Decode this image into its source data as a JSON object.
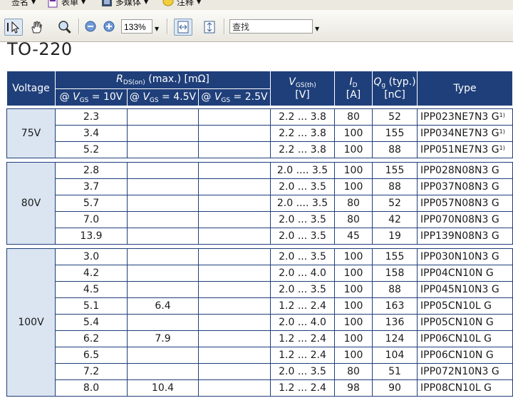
{
  "menubar": {
    "items": [
      {
        "label": "签名",
        "icon": "pen-icon"
      },
      {
        "label": "表单",
        "icon": "form-icon"
      },
      {
        "label": "多媒体",
        "icon": "film-icon"
      },
      {
        "label": "注释",
        "icon": "comment-icon"
      }
    ]
  },
  "toolbar": {
    "zoom_value": "133%",
    "find_placeholder": "查找"
  },
  "document": {
    "title": "TO-220",
    "header": {
      "voltage": "Voltage",
      "rds_label": "R",
      "rds_sub": "DS(on)",
      "rds_rest": " (max.) [mΩ]",
      "vgs10_pre": "@ ",
      "vgs10_v": "V",
      "vgs10_sub": "GS",
      "vgs10_post": " = 10V",
      "vgs45_post": " = 4.5V",
      "vgs25_post": " = 2.5V",
      "vgsth_v": "V",
      "vgsth_sub": "GS(th)",
      "vgsth_unit": "[V]",
      "id_i": "I",
      "id_sub": "D",
      "id_unit": "[A]",
      "qg_q": "Q",
      "qg_sub": "g",
      "qg_rest": " (typ.)",
      "qg_unit": "[nC]",
      "type": "Type"
    },
    "groups": [
      {
        "voltage": "75V",
        "rows": [
          {
            "r10": "2.3",
            "r45": "",
            "r25": "",
            "vgsth": "2.2 ... 3.8",
            "id": "80",
            "qg": "52",
            "type": "IPP023NE7N3 G",
            "note": "1)"
          },
          {
            "r10": "3.4",
            "r45": "",
            "r25": "",
            "vgsth": "2.2 ... 3.8",
            "id": "100",
            "qg": "155",
            "type": "IPP034NE7N3 G",
            "note": "1)"
          },
          {
            "r10": "5.2",
            "r45": "",
            "r25": "",
            "vgsth": "2.2 ... 3.8",
            "id": "100",
            "qg": "88",
            "type": "IPP051NE7N3 G",
            "note": "1)"
          }
        ]
      },
      {
        "voltage": "80V",
        "rows": [
          {
            "r10": "2.8",
            "r45": "",
            "r25": "",
            "vgsth": "2.0 .... 3.5",
            "id": "100",
            "qg": "155",
            "type": "IPP028N08N3 G",
            "note": ""
          },
          {
            "r10": "3.7",
            "r45": "",
            "r25": "",
            "vgsth": "2.0 ... 3.5",
            "id": "100",
            "qg": "88",
            "type": "IPP037N08N3 G",
            "note": ""
          },
          {
            "r10": "5.7",
            "r45": "",
            "r25": "",
            "vgsth": "2.0 .... 3.5",
            "id": "80",
            "qg": "52",
            "type": "IPP057N08N3 G",
            "note": ""
          },
          {
            "r10": "7.0",
            "r45": "",
            "r25": "",
            "vgsth": "2.0 ... 3.5",
            "id": "80",
            "qg": "42",
            "type": "IPP070N08N3 G",
            "note": ""
          },
          {
            "r10": "13.9",
            "r45": "",
            "r25": "",
            "vgsth": "2.0 ... 3.5",
            "id": "45",
            "qg": "19",
            "type": "IPP139N08N3 G",
            "note": ""
          }
        ]
      },
      {
        "voltage": "100V",
        "rows": [
          {
            "r10": "3.0",
            "r45": "",
            "r25": "",
            "vgsth": "2.0 ... 3.5",
            "id": "100",
            "qg": "155",
            "type": "IPP030N10N3 G",
            "note": ""
          },
          {
            "r10": "4.2",
            "r45": "",
            "r25": "",
            "vgsth": "2.0 ... 4.0",
            "id": "100",
            "qg": "158",
            "type": "IPP04CN10N G",
            "note": ""
          },
          {
            "r10": "4.5",
            "r45": "",
            "r25": "",
            "vgsth": "2.0 ... 3.5",
            "id": "100",
            "qg": "88",
            "type": "IPP045N10N3 G",
            "note": ""
          },
          {
            "r10": "5.1",
            "r45": "6.4",
            "r25": "",
            "vgsth": "1.2 ... 2.4",
            "id": "100",
            "qg": "163",
            "type": "IPP05CN10L G",
            "note": ""
          },
          {
            "r10": "5.4",
            "r45": "",
            "r25": "",
            "vgsth": "2.0 ... 4.0",
            "id": "100",
            "qg": "136",
            "type": "IPP05CN10N G",
            "note": ""
          },
          {
            "r10": "6.2",
            "r45": "7.9",
            "r25": "",
            "vgsth": "1.2 ... 2.4",
            "id": "100",
            "qg": "124",
            "type": "IPP06CN10L G",
            "note": ""
          },
          {
            "r10": "6.5",
            "r45": "",
            "r25": "",
            "vgsth": "1.2 ... 2.4",
            "id": "100",
            "qg": "104",
            "type": "IPP06CN10N G",
            "note": ""
          },
          {
            "r10": "7.2",
            "r45": "",
            "r25": "",
            "vgsth": "2.0 ... 3.5",
            "id": "80",
            "qg": "51",
            "type": "IPP072N10N3 G",
            "note": ""
          },
          {
            "r10": "8.0",
            "r45": "10.4",
            "r25": "",
            "vgsth": "1.2 ... 2.4",
            "id": "98",
            "qg": "90",
            "type": "IPP08CN10L G",
            "note": ""
          }
        ]
      }
    ]
  },
  "colors": {
    "header_bg": "#1f3f7a",
    "voltage_bg": "#dbe5f1"
  }
}
